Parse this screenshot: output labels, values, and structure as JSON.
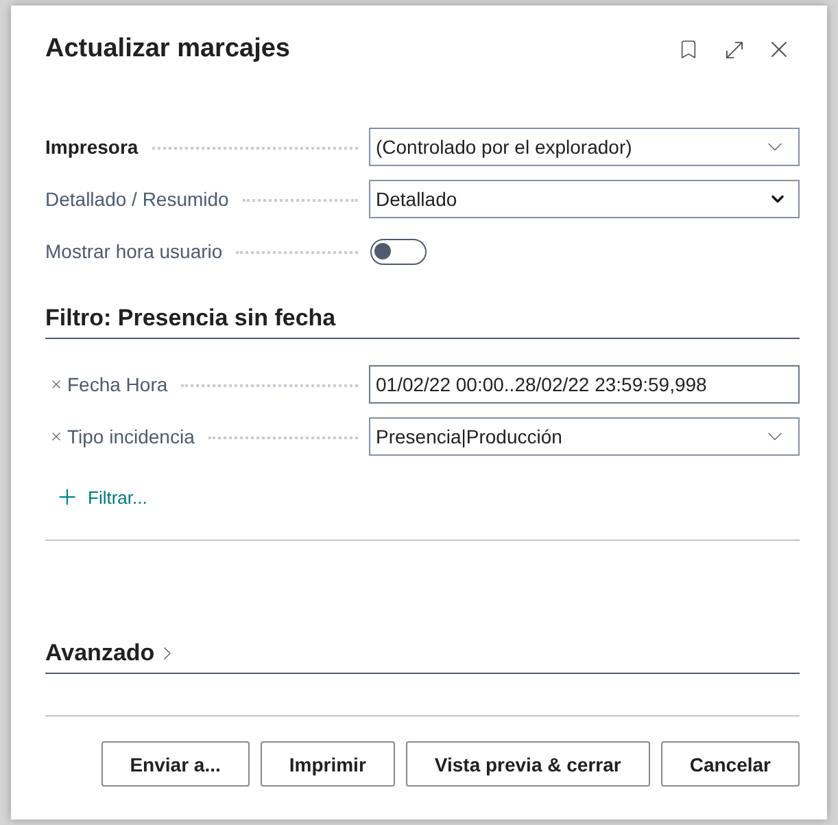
{
  "dialog": {
    "title": "Actualizar marcajes"
  },
  "options": [
    {
      "kind": "lookup",
      "label": "Impresora",
      "emphasized": true,
      "value": "(Controlado por el explorador)"
    },
    {
      "kind": "select",
      "label": "Detallado / Resumido",
      "emphasized": false,
      "value": "Detallado"
    },
    {
      "kind": "toggle",
      "label": "Mostrar hora usuario",
      "emphasized": false,
      "on": false
    }
  ],
  "filter": {
    "title": "Filtro: Presencia sin fecha",
    "rows": [
      {
        "kind": "text",
        "label": "Fecha Hora",
        "value": "01/02/22 00:00..28/02/22 23:59:59,998"
      },
      {
        "kind": "lookup",
        "label": "Tipo incidencia",
        "value": "Presencia|Producción"
      }
    ],
    "add_filter": "Filtrar..."
  },
  "advanced": {
    "title": "Avanzado",
    "expanded": false
  },
  "buttons": [
    "Enviar a...",
    "Imprimir",
    "Vista previa & cerrar",
    "Cancelar"
  ]
}
